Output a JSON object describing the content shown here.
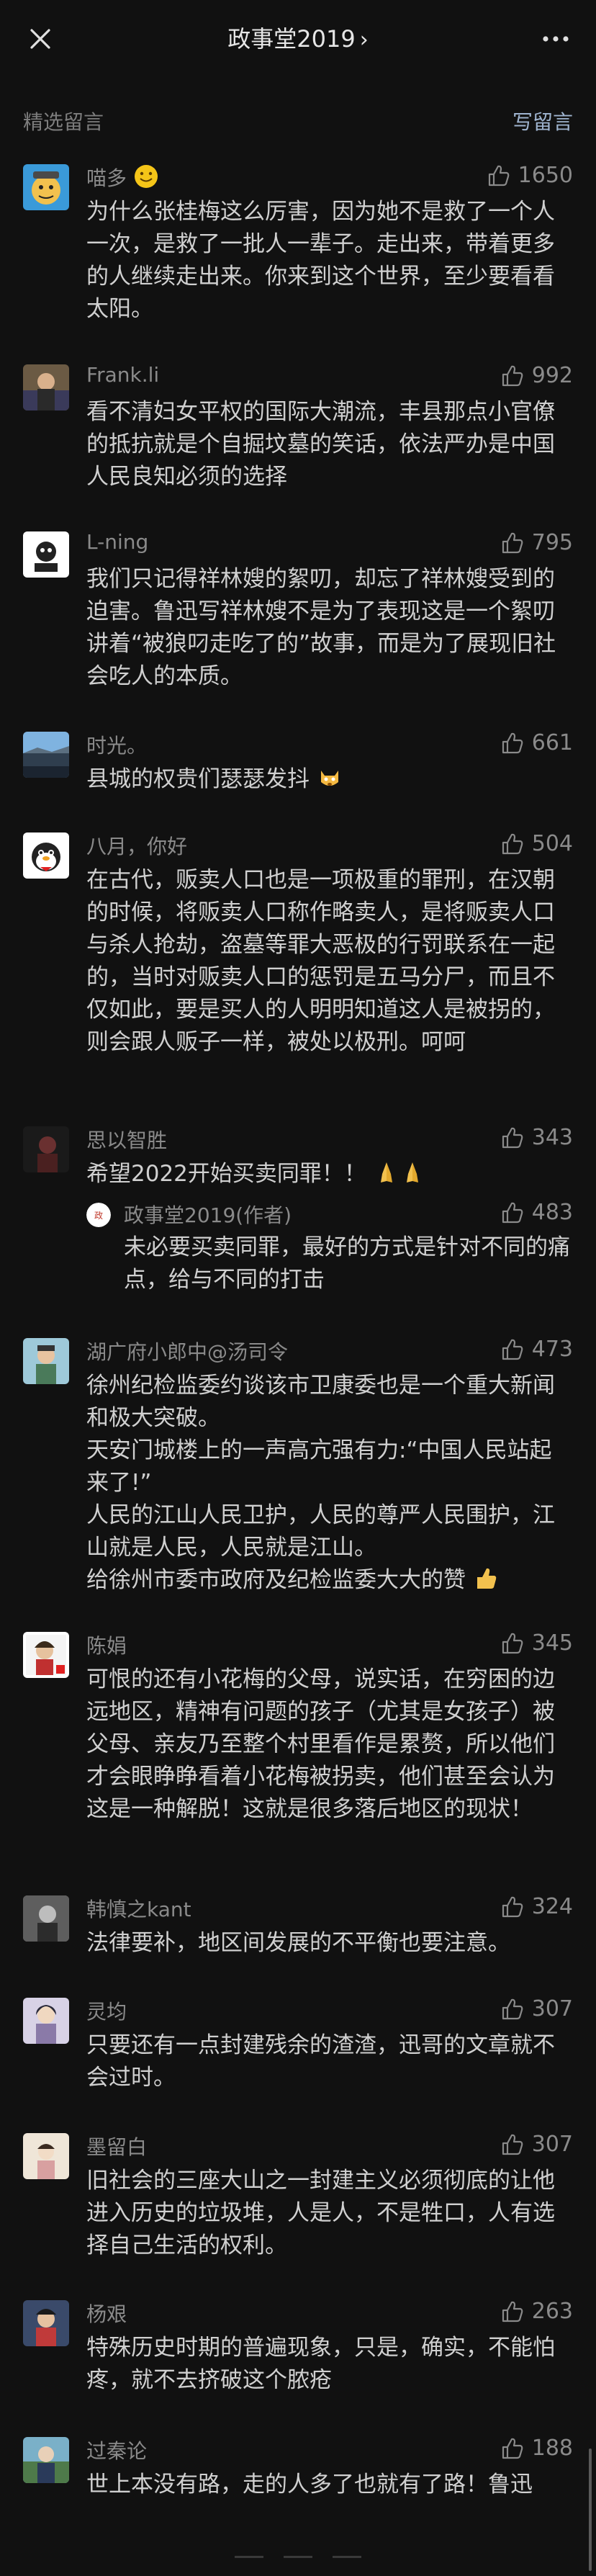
{
  "header": {
    "title": "政事堂2019",
    "chevron": "›",
    "close_icon": "close-icon",
    "more_icon": "more-icon"
  },
  "section": {
    "label": "精选留言",
    "write_link": "写留言"
  },
  "comments": [
    {
      "name": "喵多",
      "likes": "1650",
      "name_emoji": "smile-emoji",
      "body": [
        "为什么张桂梅这么厉害，因为她不是救了一个人一次，是救了一批人一辈子。走出来，带着更多的人继续走出来。你来到这个世界，至少要看看太阳。"
      ]
    },
    {
      "name": "Frank.li",
      "likes": "992",
      "body": [
        "看不清妇女平权的国际大潮流，丰县那点小官僚的抵抗就是个自掘坟墓的笑话，依法严办是中国人民良知必须的选择"
      ]
    },
    {
      "name": "L-ning",
      "likes": "795",
      "body": [
        "我们只记得祥林嫂的絮叨，却忘了祥林嫂受到的迫害。鲁迅写祥林嫂不是为了表现这是一个絮叨讲着“被狼叼走吃了的”故事，而是为了展现旧社会吃人的本质。"
      ]
    },
    {
      "name": "时光。",
      "likes": "661",
      "body": [
        "县城的权贵们瑟瑟发抖"
      ]
    },
    {
      "name": "八月，你好",
      "likes": "504",
      "body": [
        "在古代，贩卖人口也是一项极重的罪刑，在汉朝的时候，将贩卖人口称作略卖人，是将贩卖人口与杀人抢劫，盗墓等罪大恶极的行罚联系在一起的，当时对贩卖人口的惩罚是五马分尸，而且不仅如此，要是买人的人明明知道这人是被拐的，则会跟人贩子一样，被处以极刑。呵呵"
      ]
    },
    {
      "name": "思以智胜",
      "likes": "343",
      "body": [
        "希望2022开始买卖同罪！！"
      ],
      "reply": {
        "name": "政事堂2019(作者)",
        "likes": "483",
        "body": "未必要买卖同罪，最好的方式是针对不同的痛点，给与不同的打击"
      }
    },
    {
      "name": "湖广府小郎中@汤司令",
      "likes": "473",
      "body": [
        "徐州纪检监委约谈该市卫康委也是一个重大新闻和极大突破。",
        "天安门城楼上的一声高亢强有力:“中国人民站起来了!”",
        "人民的江山人民卫护，人民的尊严人民围护，江山就是人民，人民就是江山。",
        "给徐州市委市政府及纪检监委大大的赞"
      ]
    },
    {
      "name": "陈娟",
      "likes": "345",
      "body": [
        "可恨的还有小花梅的父母，说实话，在穷困的边远地区，精神有问题的孩子（尤其是女孩子）被父母、亲友乃至整个村里看作是累赘，所以他们才会眼睁睁看着小花梅被拐卖，他们甚至会认为这是一种解脱！这就是很多落后地区的现状！"
      ]
    },
    {
      "name": "韩慎之kant",
      "likes": "324",
      "body": [
        "法律要补，地区间发展的不平衡也要注意。"
      ]
    },
    {
      "name": "灵均",
      "likes": "307",
      "body": [
        "只要还有一点封建残余的渣渣，迅哥的文章就不会过时。"
      ]
    },
    {
      "name": "墨留白",
      "likes": "307",
      "body": [
        "旧社会的三座大山之一封建主义必须彻底的让他进入历史的垃圾堆，人是人，不是牲口，人有选择自己生活的权利。"
      ]
    },
    {
      "name": "杨艰",
      "likes": "263",
      "body": [
        "特殊历史时期的普遍现象，只是，确实，不能怕疼，就不去挤破这个脓疮"
      ]
    },
    {
      "name": "过秦论",
      "likes": "188",
      "body": [
        "世上本没有路，走的人多了也就有了路！鲁迅"
      ]
    }
  ],
  "colors": {
    "background": "#111111",
    "text": "#d0d0d0",
    "meta": "#8a8a8a",
    "link": "#9fb4cf"
  }
}
